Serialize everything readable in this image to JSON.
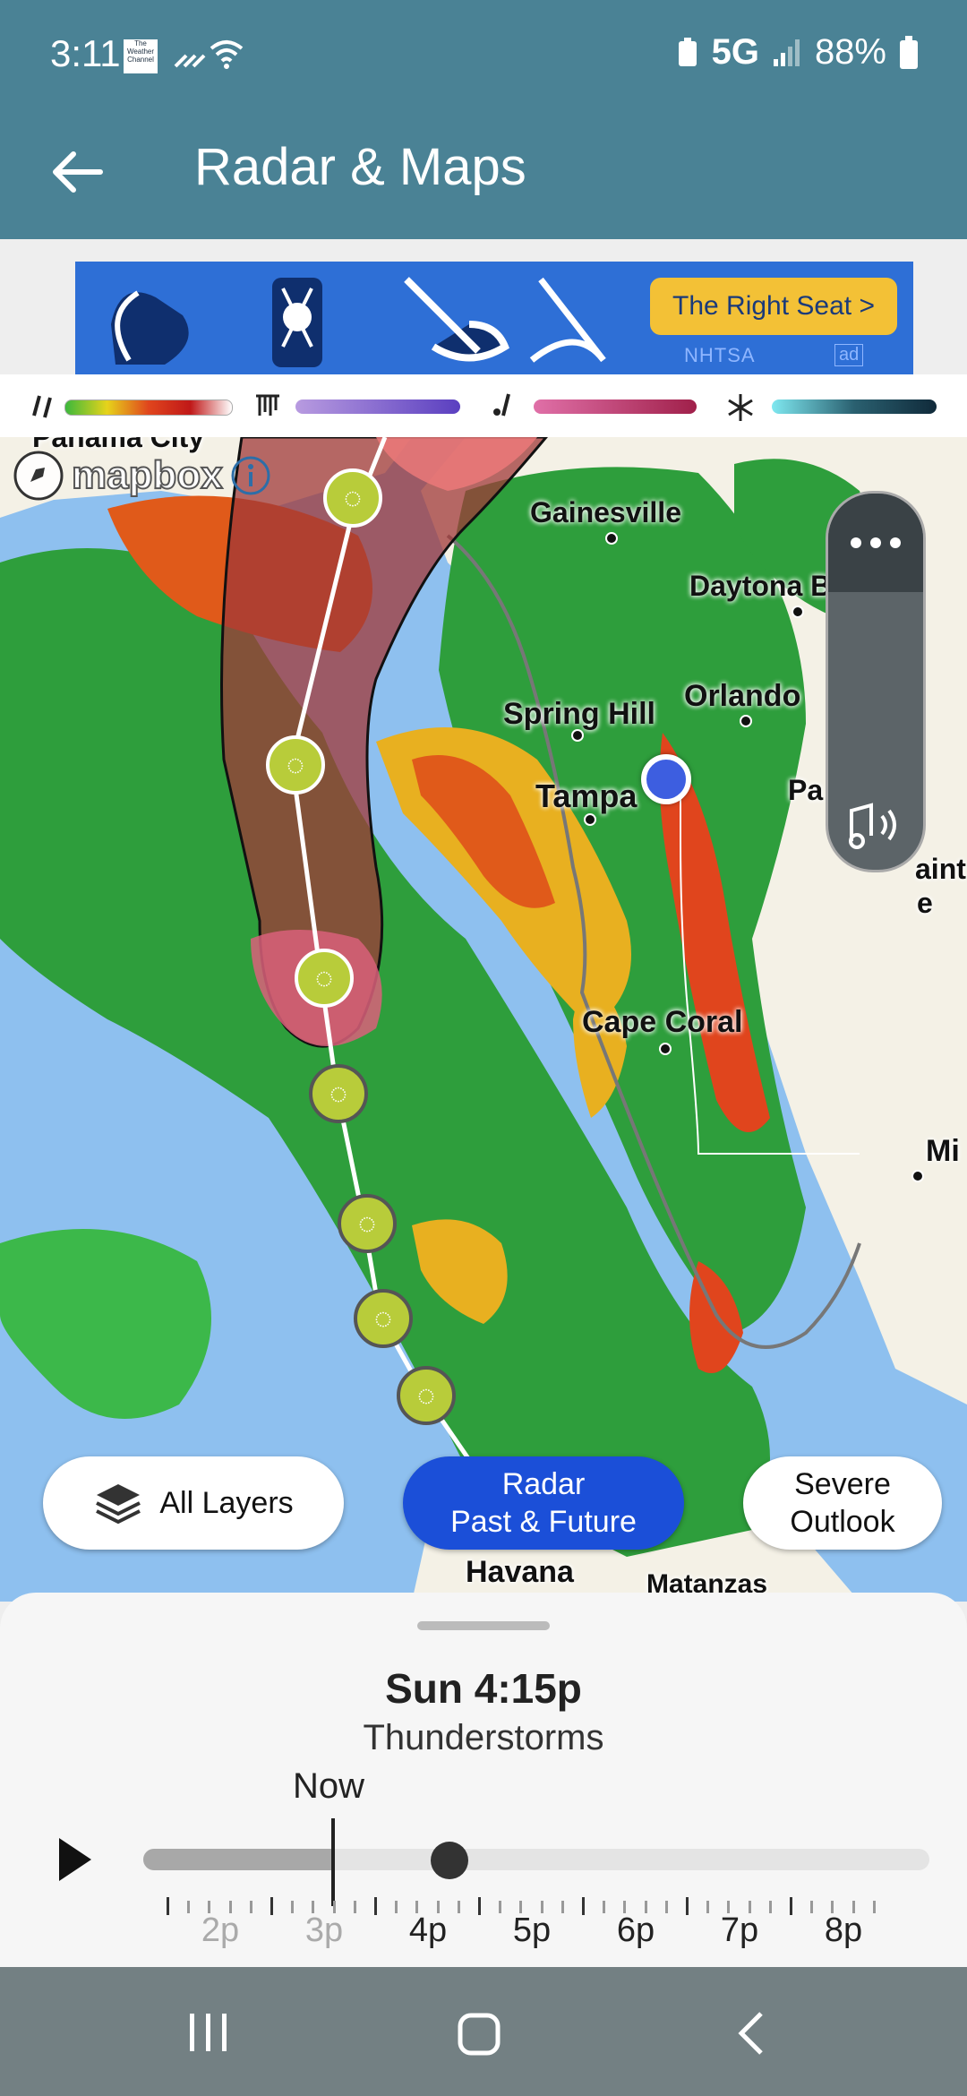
{
  "status_bar": {
    "time": "3:11",
    "app_badge": "The Weather Channel",
    "network": "5G",
    "battery": "88%"
  },
  "app_bar": {
    "title": "Radar & Maps"
  },
  "ad": {
    "cta": "The Right Seat >",
    "sponsor": "NHTSA",
    "tag": "ad"
  },
  "legend": [
    {
      "icon": "rain-icon",
      "gradient": [
        "#3cb83c",
        "#e6d31b",
        "#e0451d",
        "#ffffff"
      ]
    },
    {
      "icon": "ice-icon",
      "gradient": [
        "#b89be0",
        "#5a3fc0"
      ]
    },
    {
      "icon": "mix-icon",
      "gradient": [
        "#e070a8",
        "#a0204a"
      ]
    },
    {
      "icon": "snow-icon",
      "gradient": [
        "#7fe8f0",
        "#102a3a"
      ]
    }
  ],
  "map": {
    "attribution": "mapbox",
    "cities": [
      "Panama City",
      "Gainesville",
      "Daytona B",
      "Spring Hill",
      "Orlando",
      "Tampa",
      "Pa",
      "aint",
      "e",
      "Cape Coral",
      "Mi",
      "Havana",
      "Matanzas"
    ]
  },
  "buttons": {
    "layers": "All Layers",
    "radar": "Radar\nPast & Future",
    "severe": "Severe\nOutlook"
  },
  "timeline": {
    "time": "Sun 4:15p",
    "condition": "Thunderstorms",
    "now_label": "Now",
    "hours": [
      "2p",
      "3p",
      "4p",
      "5p",
      "6p",
      "7p",
      "8p"
    ],
    "past_hours": [
      "2p",
      "3p"
    ],
    "position_fraction": 0.39
  },
  "colors": {
    "header": "#4a8295",
    "accent": "#1b4fd8",
    "nav": "#738083"
  }
}
